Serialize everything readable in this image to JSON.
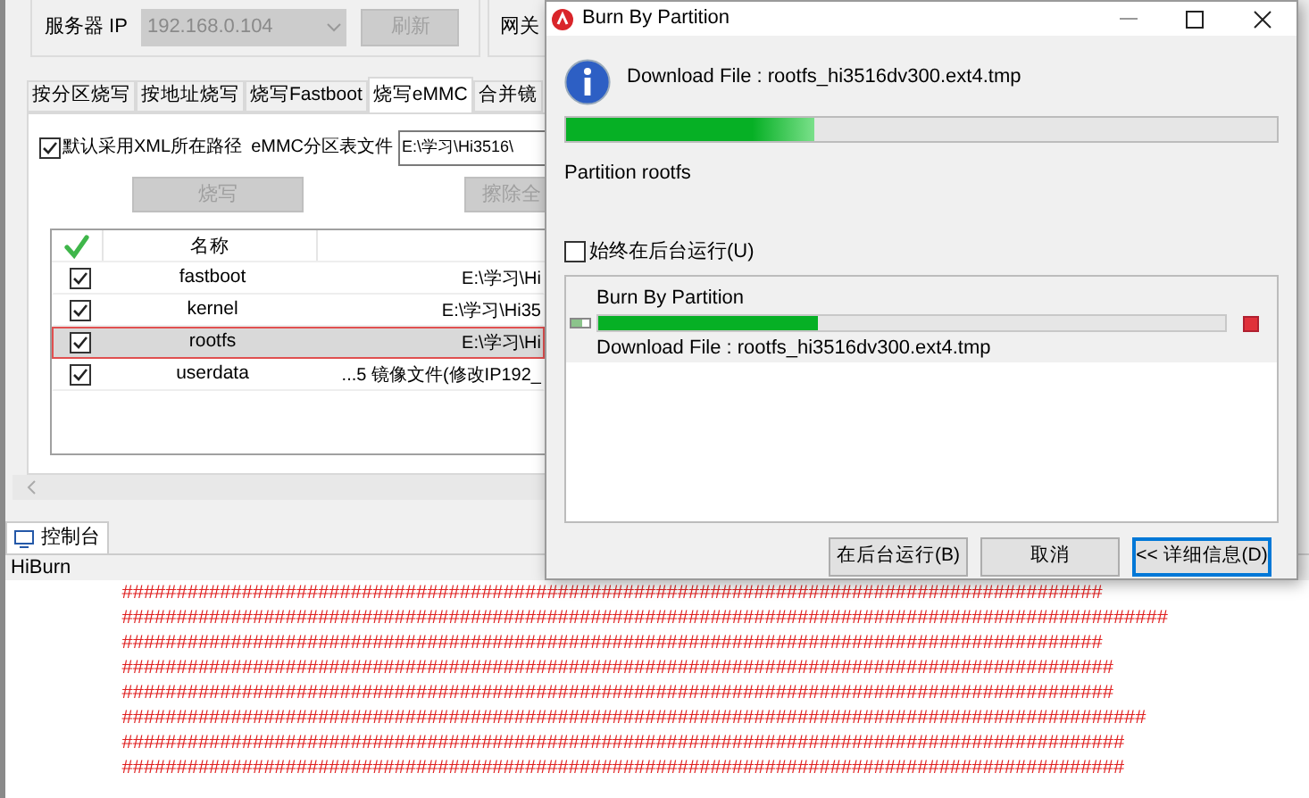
{
  "server_group": {
    "ip_label": "服务器 IP",
    "ip_value": "192.168.0.104",
    "refresh_button": {
      "label": "刷新",
      "disabled": true
    },
    "gateway_label": "网关"
  },
  "tabs": [
    {
      "label": "按分区烧写",
      "selected": false
    },
    {
      "label": "按地址烧写",
      "selected": false
    },
    {
      "label": "烧写Fastboot",
      "selected": false
    },
    {
      "label": "烧写eMMC",
      "selected": true
    },
    {
      "label": "合并镜",
      "selected": false
    }
  ],
  "emmc_panel": {
    "use_xml_path": {
      "label": "默认采用XML所在路径",
      "checked": true
    },
    "table_file_label": "eMMC分区表文件",
    "table_file_value": "E:\\学习\\Hi3516\\",
    "burn_button": {
      "label": "烧写",
      "disabled": true
    },
    "erase_button": {
      "label": "擦除全",
      "disabled": true
    }
  },
  "table": {
    "columns": [
      "名称"
    ],
    "rows": [
      {
        "checked": true,
        "name": "fastboot",
        "file": "E:\\学习\\Hi",
        "selected": false
      },
      {
        "checked": true,
        "name": "kernel",
        "file": "E:\\学习\\Hi35",
        "selected": false
      },
      {
        "checked": true,
        "name": "rootfs",
        "file": "E:\\学习\\Hi",
        "selected": true
      },
      {
        "checked": true,
        "name": "userdata",
        "file": "...5 镜像文件(修改IP192_",
        "selected": false
      }
    ]
  },
  "console": {
    "tab": "控制台",
    "source": "HiBurn",
    "lines": [
      "##########################################################################################",
      "################################################################################################",
      "##########################################################################################",
      "###########################################################################################",
      "###########################################################################################",
      "##############################################################################################",
      "############################################################################################",
      "############################################################################################"
    ]
  },
  "dialog": {
    "title": "Burn By Partition",
    "message": "Download File : rootfs_hi3516dv300.ext4.tmp",
    "progress": {
      "level": 0.35
    },
    "status": "Partition rootfs",
    "background_checkbox": {
      "label": "始终在后台运行(U)",
      "checked": false
    },
    "task": {
      "title": "Burn By Partition",
      "level": 0.35,
      "detail": "Download File : rootfs_hi3516dv300.ext4.tmp"
    },
    "buttons": [
      {
        "label": "在后台运行(B)",
        "default": false
      },
      {
        "label": "取消",
        "default": false
      },
      {
        "label": "<< 详细信息(D)",
        "default": true
      }
    ]
  }
}
